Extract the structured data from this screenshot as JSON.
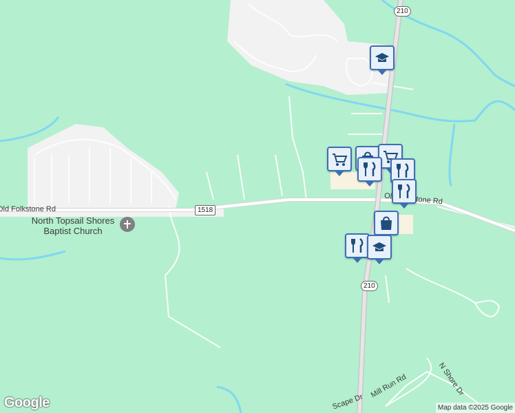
{
  "map": {
    "type": "road-map",
    "colors": {
      "land": "#b4efcf",
      "developed": "#f2f2f2",
      "road": "#ffffff",
      "highway": "#d6d6d6",
      "water": "#7fd8f0",
      "pin_fill": "#e8f0fa",
      "pin_border": "#3c6fb4"
    }
  },
  "roads": {
    "old_folkstone": "Old Folkstone Rd",
    "old_folkstone_east": "Old Folkstone Rd",
    "mill_run": "Mill Run Rd",
    "n_shore": "N Shore Dr",
    "scape": "Scape Dr"
  },
  "shields": {
    "sr1518": "1518",
    "nc210_top": "210",
    "nc210_bottom": "210"
  },
  "poi": {
    "church": "North Topsail Shores Baptist Church"
  },
  "pins": [
    {
      "name": "school",
      "icon": "graduation-cap-icon"
    },
    {
      "name": "grocery",
      "icon": "shopping-cart-icon"
    },
    {
      "name": "shopping",
      "icon": "shopping-bag-icon"
    },
    {
      "name": "grocery",
      "icon": "shopping-cart-icon"
    },
    {
      "name": "restaurant",
      "icon": "fork-knife-icon"
    },
    {
      "name": "restaurant",
      "icon": "fork-knife-icon"
    },
    {
      "name": "restaurant",
      "icon": "fork-knife-icon"
    },
    {
      "name": "shopping",
      "icon": "shopping-bag-icon"
    },
    {
      "name": "restaurant",
      "icon": "fork-knife-icon"
    },
    {
      "name": "school",
      "icon": "graduation-cap-icon"
    }
  ],
  "branding": {
    "logo": "Google",
    "attribution": "Map data ©2025 Google"
  }
}
